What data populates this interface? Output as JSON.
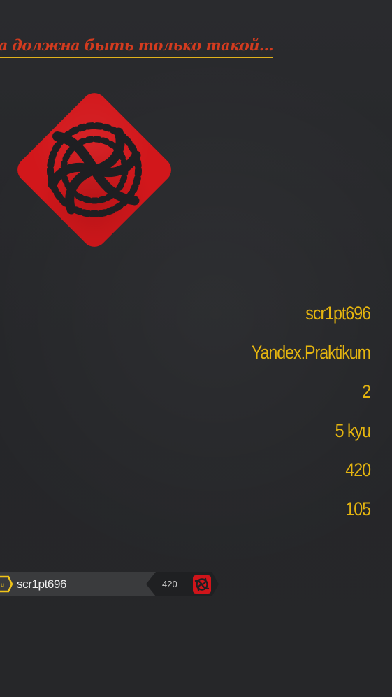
{
  "quote": {
    "text": "Война должна быть только такой..."
  },
  "profile": {
    "username": "scr1pt696",
    "clan": "Yandex.Praktikum",
    "leaderboard_position": "2",
    "rank": "5 kyu",
    "honor": "420",
    "completed_kata": "105"
  },
  "badge": {
    "username": "scr1pt696",
    "honor": "420"
  },
  "colors": {
    "accent": "#e5b50f",
    "quote_red": "#d23b1f",
    "logo_red": "#d2171b",
    "background": "#27282b"
  },
  "icons": {
    "avatar": "swirl-diamond-icon",
    "rank_badge": "hexagon-icon",
    "clan_badge": "swirl-square-icon"
  }
}
